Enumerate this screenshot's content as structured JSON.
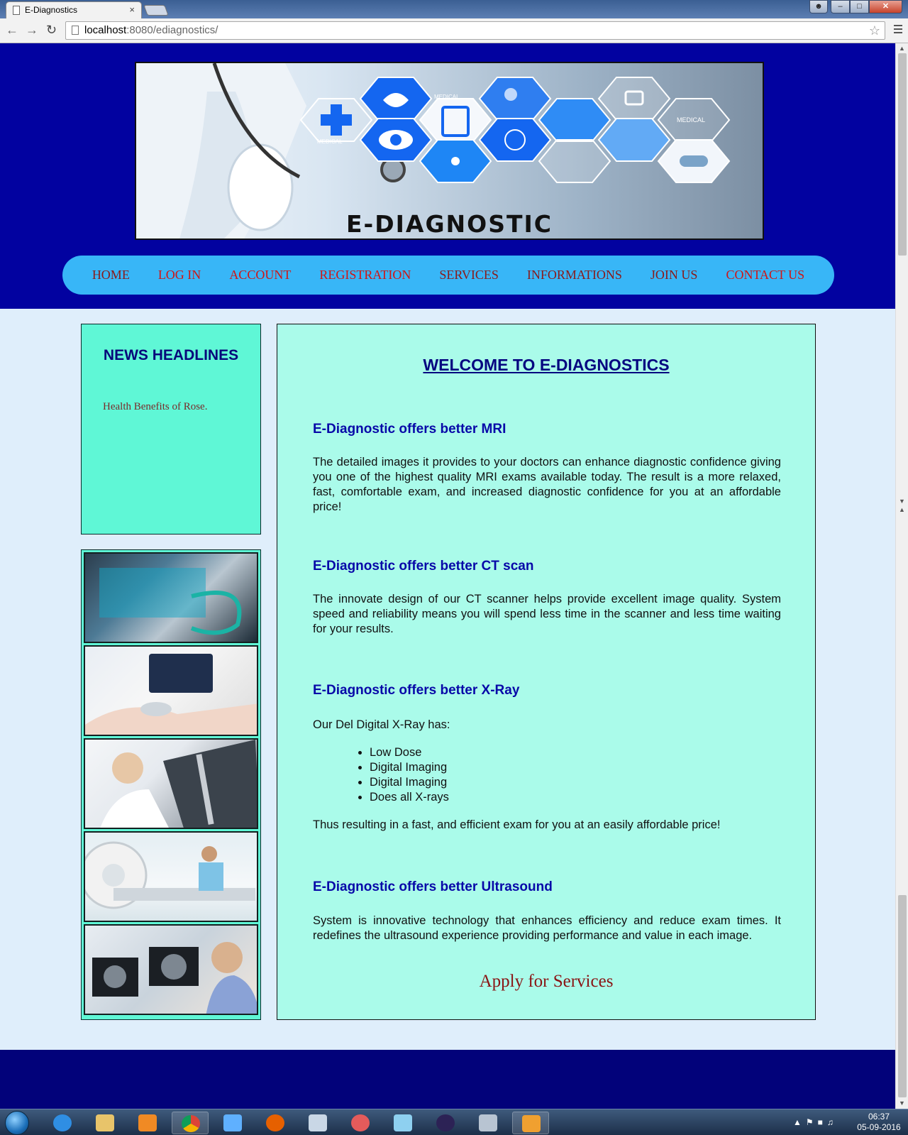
{
  "browser": {
    "tab_title": "E-Diagnostics",
    "tab_close": "×",
    "url_host": "localhost",
    "url_path": ":8080/ediagnostics/",
    "win_close": "✕",
    "win_max": "□",
    "win_min": "–"
  },
  "header": {
    "banner_title": "E-DIAGNOSTIC",
    "banner_labels": [
      "MEDICAL",
      "MEDICAL",
      "MEDICAL"
    ]
  },
  "nav": {
    "items": [
      {
        "label": "HOME",
        "color": "#8a1a1a"
      },
      {
        "label": "LOG IN",
        "color": "#d01515"
      },
      {
        "label": "ACCOUNT",
        "color": "#d01515"
      },
      {
        "label": "REGISTRATION",
        "color": "#d01515"
      },
      {
        "label": "SERVICES",
        "color": "#8a1a1a"
      },
      {
        "label": "INFORMATIONS",
        "color": "#8a1a1a"
      },
      {
        "label": "JOIN US",
        "color": "#8a1a1a"
      },
      {
        "label": "CONTACT US",
        "color": "#d01515"
      }
    ]
  },
  "sidebar": {
    "news_title": "NEWS HEADLINES",
    "news_items": [
      "Health Benefits of Rose."
    ]
  },
  "main": {
    "welcome": "WELCOME TO E-DIAGNOSTICS",
    "mri": {
      "heading": "E-Diagnostic offers better MRI",
      "text": "The detailed images it provides to your doctors can enhance diagnostic confidence giving you one of the highest quality MRI exams available today. The result is a more relaxed, fast, comfortable exam, and increased diagnostic confidence for you at an affordable price!"
    },
    "ct": {
      "heading": "E-Diagnostic offers better CT scan",
      "text": "The innovate design of our CT scanner helps provide excellent image quality. System speed and reliability means you will spend less time in the scanner and less time waiting for your results."
    },
    "xray": {
      "heading": "E-Diagnostic offers better X-Ray",
      "intro": "Our Del Digital X-Ray has:",
      "bullets": [
        "Low Dose",
        "Digital Imaging",
        "Digital Imaging",
        "Does all X-rays"
      ],
      "outro": "Thus resulting in a fast, and efficient exam for you at an easily affordable price!"
    },
    "ultrasound": {
      "heading": "E-Diagnostic offers better Ultrasound",
      "text": "System is innovative technology that enhances efficiency and reduce exam times. It redefines the ultrasound experience providing performance and value in each image."
    },
    "apply_link": "Apply for Services"
  },
  "taskbar": {
    "time": "06:37",
    "date": "05-09-2016",
    "apps": [
      "internet-explorer",
      "file-explorer",
      "media-player",
      "chrome",
      "winamp",
      "firefox",
      "paint",
      "snipping-tool",
      "notepad",
      "eclipse",
      "calculator",
      "java-ee-ide"
    ]
  },
  "colors": {
    "header_bg": "#0202a0",
    "nav_bg": "#38b6f7",
    "news_bg": "#5ff7d6",
    "content_bg": "#aafbea",
    "heading_blue": "#0808a8",
    "apply_red": "#8a1414",
    "footer_bg": "#02027a"
  }
}
